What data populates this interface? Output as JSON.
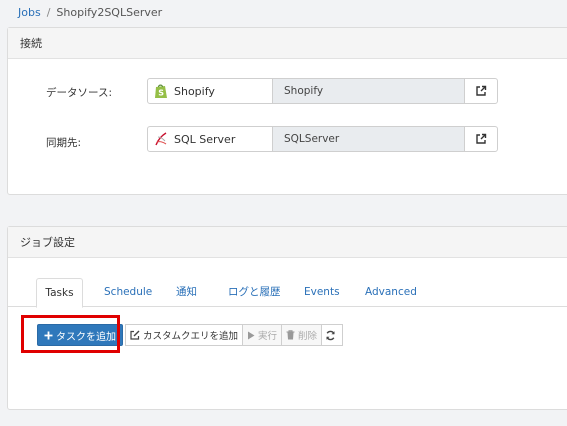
{
  "breadcrumb": {
    "root": "Jobs",
    "separator": "/",
    "current": "Shopify2SQLServer"
  },
  "connection": {
    "title": "接続",
    "source": {
      "label": "データソース:",
      "name": "Shopify",
      "value": "Shopify"
    },
    "destination": {
      "label": "同期先:",
      "name": "SQL Server",
      "value": "SQLServer"
    }
  },
  "job_settings": {
    "title": "ジョブ設定",
    "tabs": [
      "Tasks",
      "Schedule",
      "通知",
      "ログと履歴",
      "Events",
      "Advanced"
    ],
    "active_tab": "Tasks",
    "toolbar": {
      "add_task": "タスクを追加",
      "add_custom_query": "カスタムクエリを追加",
      "run": "実行",
      "delete": "削除"
    }
  },
  "colors": {
    "accent": "#2f78bb",
    "link": "#2a70b8",
    "highlight": "#e00000"
  }
}
